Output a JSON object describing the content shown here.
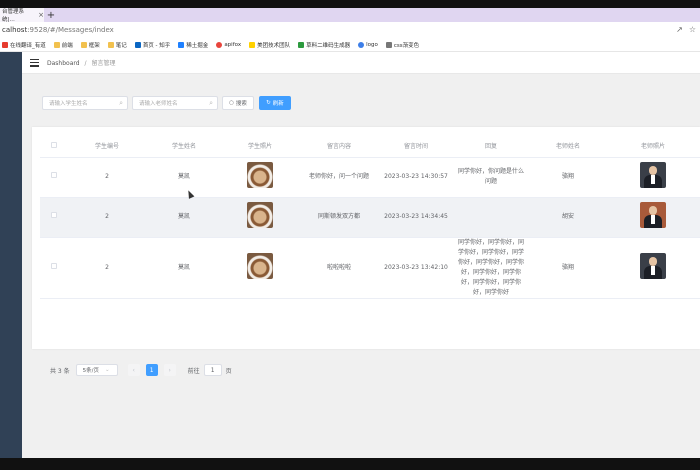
{
  "browser": {
    "tab_title": "台管理系统|…",
    "url_host": "calhost",
    "url_rest": ":9528/#/Messages/index",
    "bookmarks": [
      "在线翻译_有道",
      "前端",
      "框架",
      "笔记",
      "首页 - 知乎",
      "稀土掘金",
      "apifox",
      "美团技术团队",
      "草料二维码生成器",
      "logo",
      "css渐变色"
    ]
  },
  "breadcrumb": {
    "home": "Dashboard",
    "separator": "/",
    "current": "留言管理"
  },
  "search": {
    "student_placeholder": "请输入学生姓名",
    "teacher_placeholder": "请输入老师姓名",
    "search_label": "搜索",
    "reset_label": "刷新"
  },
  "table": {
    "headers": [
      "学生编号",
      "学生姓名",
      "学生照片",
      "留言内容",
      "留言时间",
      "回复",
      "老师姓名",
      "老师照片"
    ],
    "rows": [
      {
        "id": "2",
        "name": "莫凯",
        "content": "老师你好，问一个问题",
        "time": "2023-03-23 14:30:57",
        "reply": "同学你好，你问题是什么问题",
        "teacher": "骆翔"
      },
      {
        "id": "2",
        "name": "莫凯",
        "content": "同斯顿发双方都",
        "time": "2023-03-23 14:34:45",
        "reply": "",
        "teacher": "胡安"
      },
      {
        "id": "2",
        "name": "莫凯",
        "content": "啦啦啦啦",
        "time": "2023-03-23 13:42:10",
        "reply": "同学你好，同学你好，同学你好，同学你好，同学你好，同学你好，同学你好，同学你好，同学你好，同学你好，同学你好，同学你好",
        "teacher": "骆翔"
      }
    ]
  },
  "pagination": {
    "total": "共 3 条",
    "page_size": "5条/页",
    "prev": "‹",
    "current": "1",
    "next": "›",
    "goto": "前往",
    "jump_value": "1",
    "page_unit": "页"
  }
}
